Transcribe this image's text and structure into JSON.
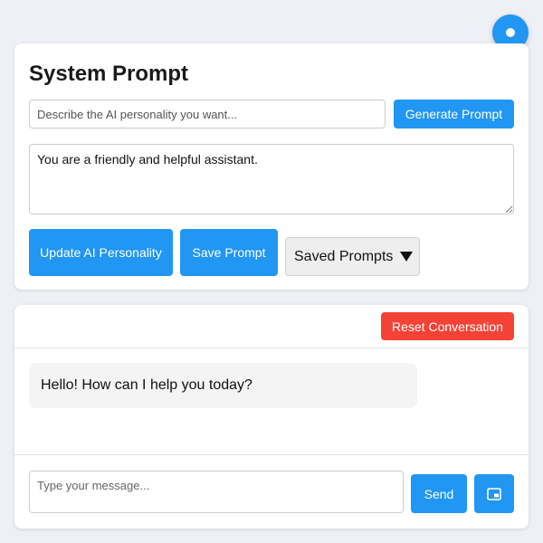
{
  "system_prompt": {
    "title": "System Prompt",
    "personality_input": {
      "value": "",
      "placeholder": "Describe the AI personality you want..."
    },
    "generate_button_label": "Generate Prompt",
    "prompt_text": "You are a friendly and helpful assistant.",
    "update_button_label": "Update AI Personality",
    "save_button_label": "Save Prompt",
    "saved_prompts_label": "Saved Prompts"
  },
  "chat": {
    "reset_button_label": "Reset Conversation",
    "messages": [
      {
        "role": "assistant",
        "text": "Hello! How can I help you today?"
      }
    ],
    "message_input": {
      "value": "",
      "placeholder": "Type your message..."
    },
    "send_button_label": "Send"
  },
  "icons": {
    "fab": "settings-toggle-icon",
    "image_button": "image-icon"
  },
  "colors": {
    "primary": "#2196f3",
    "danger": "#f44336",
    "background": "#eef0f5"
  }
}
